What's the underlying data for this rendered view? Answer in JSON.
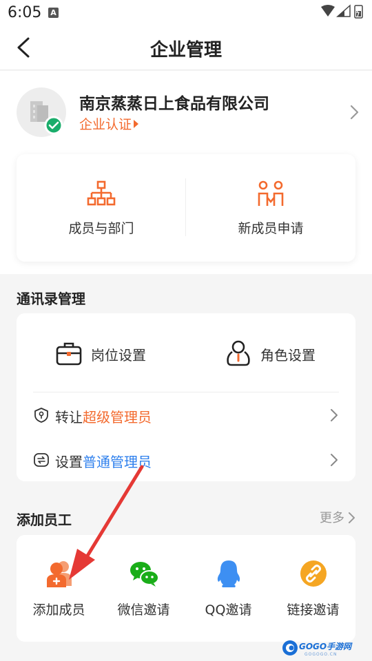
{
  "status_bar": {
    "time": "6:05",
    "notification_glyph": "A"
  },
  "header": {
    "title": "企业管理"
  },
  "company": {
    "name": "南京蒸蒸日上食品有限公司",
    "verify_label": "企业认证"
  },
  "quick_actions": [
    {
      "label": "成员与部门",
      "icon": "org-chart-icon"
    },
    {
      "label": "新成员申请",
      "icon": "people-link-icon"
    }
  ],
  "contacts_section": {
    "title": "通讯录管理",
    "tiles": [
      {
        "label": "岗位设置",
        "icon": "briefcase-icon"
      },
      {
        "label": "角色设置",
        "icon": "person-icon"
      }
    ],
    "transfer": {
      "prefix": "转让",
      "highlight": "超级管理员"
    },
    "set_admin": {
      "prefix": "设置",
      "highlight": "普通管理员"
    }
  },
  "staff_section": {
    "title": "添加员工",
    "more_label": "更多",
    "items": [
      {
        "label": "添加成员",
        "icon": "add-member-icon"
      },
      {
        "label": "微信邀请",
        "icon": "wechat-icon"
      },
      {
        "label": "QQ邀请",
        "icon": "qq-penguin-icon"
      },
      {
        "label": "链接邀请",
        "icon": "link-icon"
      }
    ]
  },
  "watermark": {
    "text": "GOGO手游网",
    "sub": "GOGOGO.CN"
  },
  "colors": {
    "accent_orange": "#f36a2e",
    "link_blue": "#2f80ed",
    "verify_green": "#1aad6b",
    "wechat_green": "#1aad19",
    "qq_blue": "#3d8ff2",
    "link_orange": "#f5a623",
    "annotation_red": "#e53935"
  }
}
